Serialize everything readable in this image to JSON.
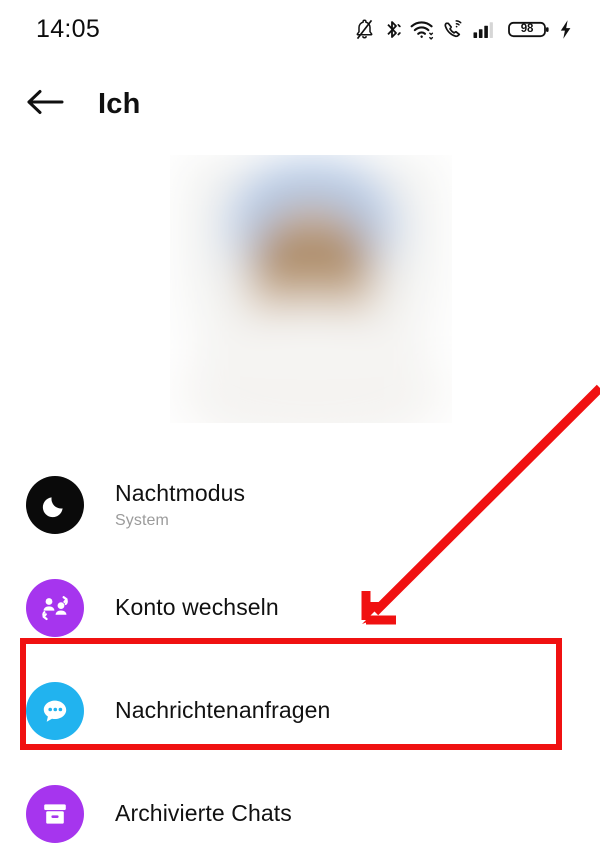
{
  "status_bar": {
    "clock": "14:05",
    "battery_level": "98",
    "icons": [
      "notifications-muted-icon",
      "bluetooth-icon",
      "wifi-icon",
      "wifi-calling-icon",
      "cellular-signal-icon",
      "battery-icon",
      "charging-bolt-icon"
    ]
  },
  "app_bar": {
    "back_icon": "back-arrow-icon",
    "title": "Ich"
  },
  "avatar": {
    "name": "profile-photo",
    "description": "blurred profile photo"
  },
  "menu": {
    "items": [
      {
        "id": "nachtmodus",
        "title": "Nachtmodus",
        "subtitle": "System",
        "icon": "moon-icon",
        "icon_bg": "#0a0a0a",
        "icon_fg": "#ffffff"
      },
      {
        "id": "konto",
        "title": "Konto wechseln",
        "subtitle": "",
        "icon": "switch-account-icon",
        "icon_bg": "#a635ee",
        "icon_fg": "#ffffff"
      },
      {
        "id": "anfragen",
        "title": "Nachrichtenanfragen",
        "subtitle": "",
        "icon": "message-requests-icon",
        "icon_bg": "#21b3ef",
        "icon_fg": "#ffffff"
      },
      {
        "id": "archiv",
        "title": "Archivierte Chats",
        "subtitle": "",
        "icon": "archive-box-icon",
        "icon_bg": "#a635ee",
        "icon_fg": "#ffffff"
      }
    ]
  },
  "annotation": {
    "highlight_color": "#f01111",
    "arrow_icon": "red-pointer-arrow",
    "box_target": "Nachrichtenanfragen"
  },
  "colors": {
    "background": "#ffffff",
    "text_primary": "#111111",
    "text_secondary": "#9b9b9b",
    "accent_purple": "#a635ee",
    "accent_cyan": "#21b3ef",
    "annotation_red": "#f01111"
  }
}
